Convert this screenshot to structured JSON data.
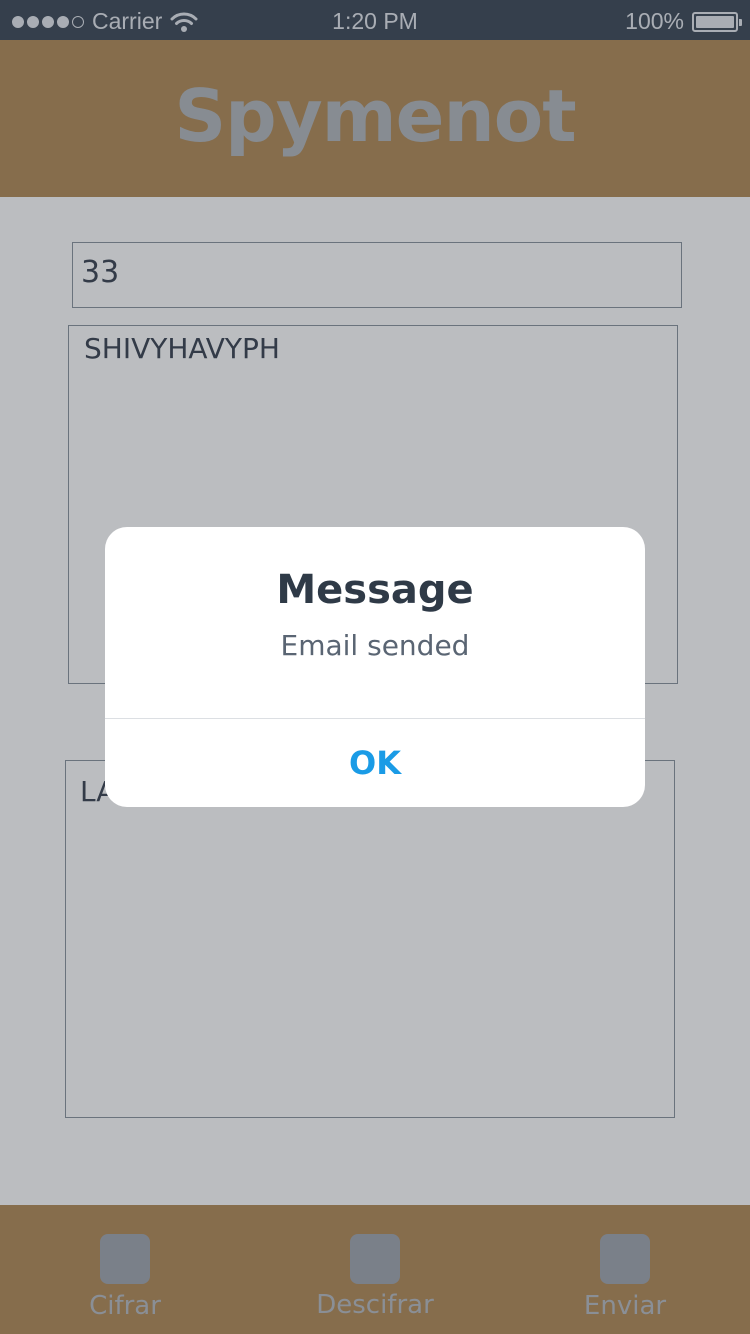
{
  "status_bar": {
    "carrier": "Carrier",
    "time": "1:20 PM",
    "battery": "100%",
    "signal_bars_filled": 4,
    "signal_bars_total": 5
  },
  "header": {
    "title": "Spymenot"
  },
  "form": {
    "key_value": "33",
    "input_text": "SHIVYHAVYPH",
    "output_text_visible": "LA"
  },
  "tabs": [
    {
      "label": "Cifrar"
    },
    {
      "label": "Descifrar"
    },
    {
      "label": "Enviar"
    }
  ],
  "alert": {
    "title": "Message",
    "message": "Email sended",
    "ok_label": "OK"
  },
  "colors": {
    "header_bg": "#b48d5a",
    "status_bg": "#3f4b5a",
    "accent": "#1a9be6"
  }
}
